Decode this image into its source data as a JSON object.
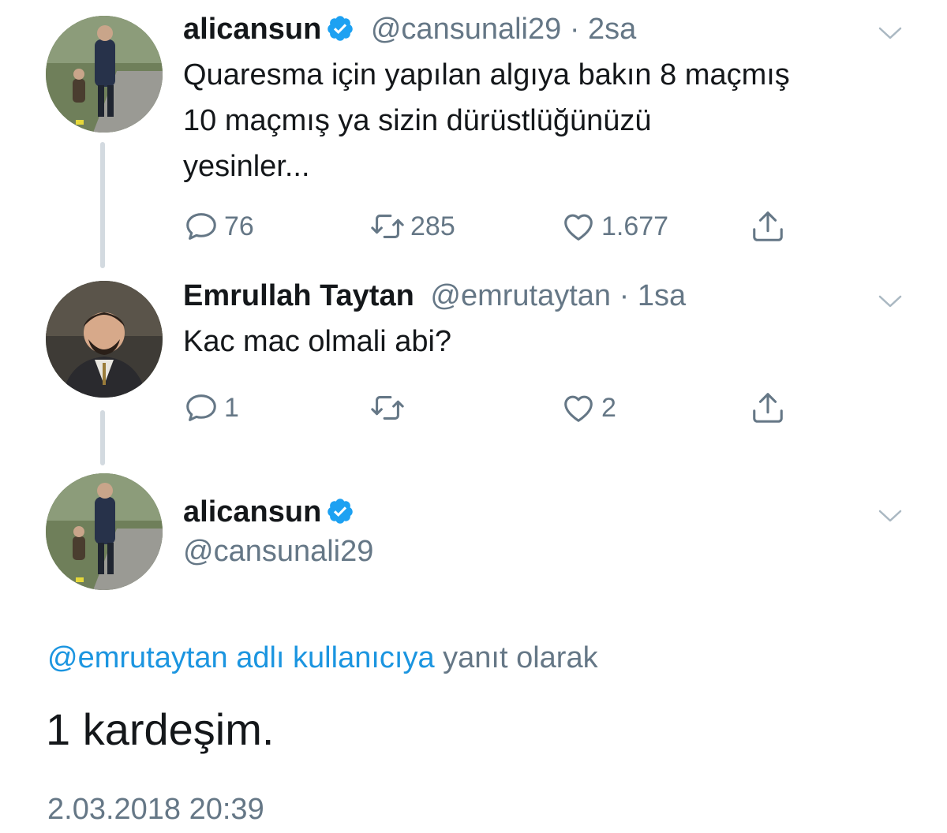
{
  "tweets": [
    {
      "display_name": "alicansun",
      "verified": true,
      "handle": "@cansunali29",
      "separator": "·",
      "time": "2sa",
      "text_lines": [
        "Quaresma için yapılan algıya bakın 8 maçmış",
        "10 maçmış ya sizin dürüstlüğünüzü",
        "yesinler..."
      ],
      "replies": "76",
      "retweets": "285",
      "likes": "1.677"
    },
    {
      "display_name": "Emrullah Taytan",
      "verified": false,
      "handle": "@emrutaytan",
      "separator": "·",
      "time": "1sa",
      "text_lines": [
        "Kac mac olmali abi?"
      ],
      "replies": "1",
      "retweets": "",
      "likes": "2"
    }
  ],
  "focus_tweet": {
    "display_name": "alicansun",
    "verified": true,
    "handle": "@cansunali29",
    "reply_context_mention": "@emrutaytan adlı kullanıcıya",
    "reply_context_suffix": " yanıt olarak",
    "text": "1 kardeşim.",
    "timestamp": "2.03.2018 20:39"
  },
  "colors": {
    "link": "#1b95e0",
    "muted": "#657786",
    "verified": "#1da1f2",
    "thread_line": "#d3dae0"
  },
  "icons": [
    "reply-icon",
    "retweet-icon",
    "like-icon",
    "share-icon",
    "verified-badge-icon",
    "chevron-down-icon"
  ]
}
